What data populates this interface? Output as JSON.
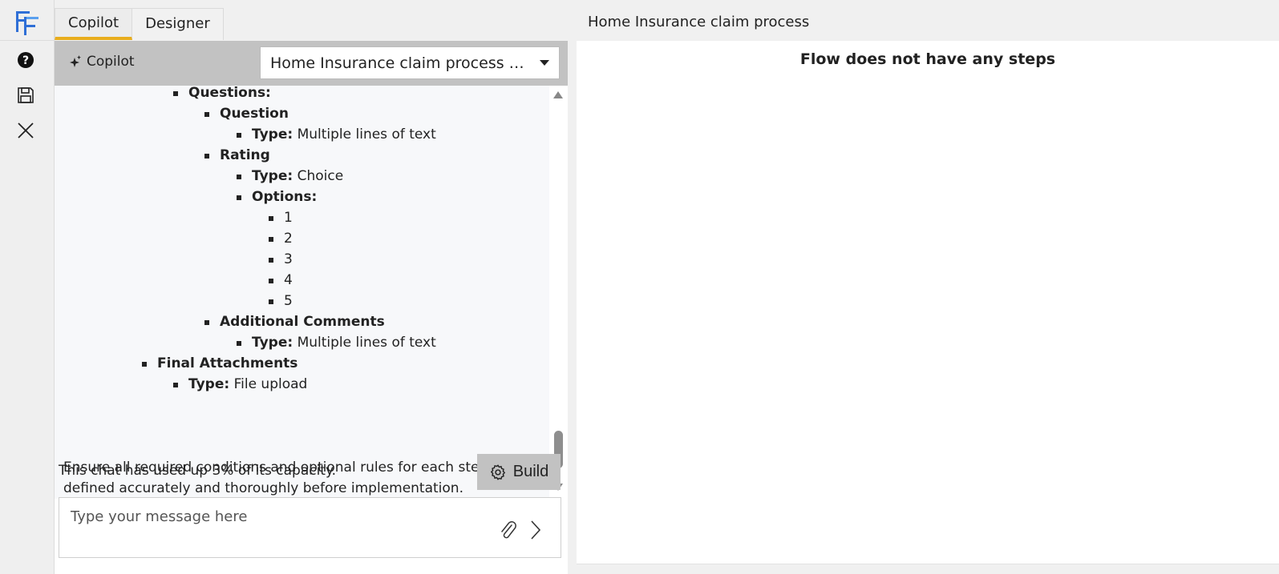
{
  "app": {
    "brand_colors": {
      "accent": "#e8ad1d",
      "logo_blue": "#2f6fd6",
      "logo_light": "#5aa0ee"
    }
  },
  "rail": {
    "items": [
      {
        "icon": "help-icon"
      },
      {
        "icon": "save-icon"
      },
      {
        "icon": "close-icon"
      }
    ]
  },
  "tabs": [
    {
      "label": "Copilot",
      "active": true
    },
    {
      "label": "Designer",
      "active": false
    }
  ],
  "copilot": {
    "title": "Copilot",
    "flow_select": {
      "value": "Home Insurance claim process - Ch..."
    },
    "chat": {
      "items": [
        {
          "bold": "Questions:",
          "text": ""
        },
        {
          "bold": "Question",
          "text": ""
        },
        {
          "bold": "Type:",
          "text": " Multiple lines of text"
        },
        {
          "bold": "Rating",
          "text": ""
        },
        {
          "bold": "Type:",
          "text": " Choice"
        },
        {
          "bold": "Options:",
          "text": ""
        },
        {
          "bold": "",
          "text": "1"
        },
        {
          "bold": "",
          "text": "2"
        },
        {
          "bold": "",
          "text": "3"
        },
        {
          "bold": "",
          "text": "4"
        },
        {
          "bold": "",
          "text": "5"
        },
        {
          "bold": "Additional Comments",
          "text": ""
        },
        {
          "bold": "Type:",
          "text": " Multiple lines of text"
        },
        {
          "bold": "Final Attachments",
          "text": ""
        },
        {
          "bold": "Type:",
          "text": " File upload"
        }
      ],
      "note": "Ensure all required conditions and optional rules for each step are defined accurately and thoroughly before implementation."
    },
    "capacity_text": "This chat has used up 3% of its capacity.",
    "build_label": "Build",
    "message": {
      "placeholder": "Type your message here",
      "value": ""
    }
  },
  "designer": {
    "title": "Home Insurance claim process",
    "empty_message": "Flow does not have any steps"
  }
}
